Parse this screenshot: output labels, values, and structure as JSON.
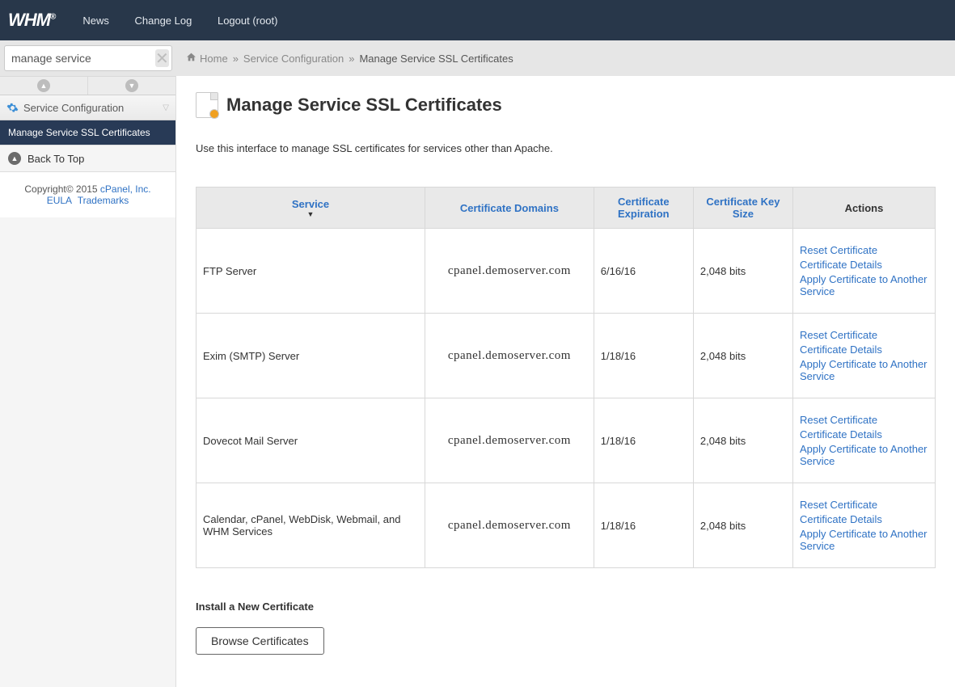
{
  "brand": "WHM",
  "topnav": {
    "news": "News",
    "changelog": "Change Log",
    "logout": "Logout (root)"
  },
  "search_value": "manage service",
  "breadcrumb": {
    "home": "Home",
    "section": "Service Configuration",
    "page": "Manage Service SSL Certificates"
  },
  "sidebar": {
    "header": "Service Configuration",
    "active_item": "Manage Service SSL Certificates",
    "back": "Back To Top",
    "footer": {
      "copyright": "Copyright© 2015 ",
      "cpanel": "cPanel, Inc.",
      "eula": "EULA",
      "trademarks": "Trademarks"
    }
  },
  "page": {
    "title": "Manage Service SSL Certificates",
    "intro": "Use this interface to manage SSL certificates for services other than Apache.",
    "install_heading": "Install a New Certificate",
    "browse_btn": "Browse Certificates"
  },
  "table": {
    "headers": {
      "service": "Service",
      "domains": "Certificate Domains",
      "expiration": "Certificate Expiration",
      "keysize": "Certificate Key Size",
      "actions": "Actions"
    },
    "action_labels": {
      "reset": "Reset Certificate",
      "details": "Certificate Details",
      "apply": "Apply Certificate to Another Service"
    },
    "rows": [
      {
        "service": "FTP Server",
        "domain": "cpanel.demoserver.com",
        "expiration": "6/16/16",
        "keysize": "2,048 bits"
      },
      {
        "service": "Exim (SMTP) Server",
        "domain": "cpanel.demoserver.com",
        "expiration": "1/18/16",
        "keysize": "2,048 bits"
      },
      {
        "service": "Dovecot Mail Server",
        "domain": "cpanel.demoserver.com",
        "expiration": "1/18/16",
        "keysize": "2,048 bits"
      },
      {
        "service": "Calendar, cPanel, WebDisk, Webmail, and WHM Services",
        "domain": "cpanel.demoserver.com",
        "expiration": "1/18/16",
        "keysize": "2,048 bits"
      }
    ]
  }
}
